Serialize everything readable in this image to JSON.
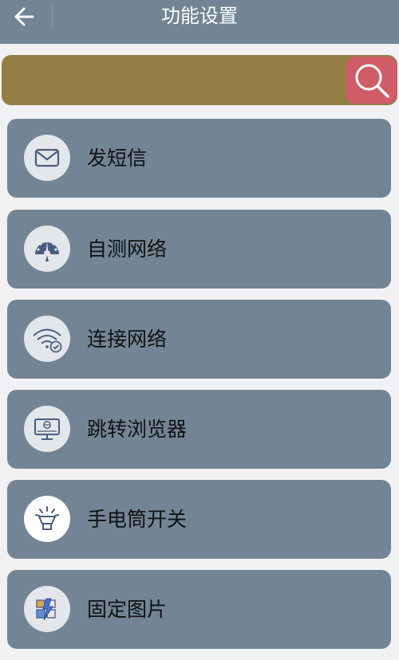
{
  "header": {
    "title": "功能设置",
    "back_icon": "arrow-left-icon"
  },
  "search": {
    "placeholder": "",
    "value": "",
    "button_icon": "search-icon",
    "bar_color": "#937f46",
    "button_color": "#cf5c67"
  },
  "menu": {
    "items": [
      {
        "label": "发短信",
        "icon": "envelope-icon"
      },
      {
        "label": "自测网络",
        "icon": "speedometer-icon"
      },
      {
        "label": "连接网络",
        "icon": "wifi-check-icon"
      },
      {
        "label": "跳转浏览器",
        "icon": "monitor-browser-icon"
      },
      {
        "label": "手电筒开关",
        "icon": "flashlight-icon"
      },
      {
        "label": "固定图片",
        "icon": "pinned-image-icon"
      }
    ]
  },
  "colors": {
    "appbar": "#738594",
    "card": "#738594",
    "background": "#f1f1f3"
  }
}
